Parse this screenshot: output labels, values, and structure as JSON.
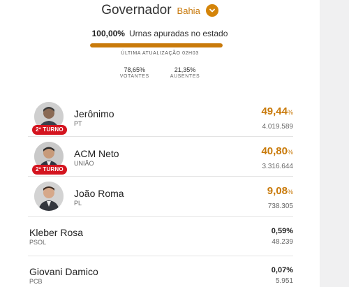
{
  "header": {
    "title": "Governador",
    "state": "Bahia",
    "icon": "chevron-down-icon"
  },
  "summary": {
    "apuradas_pct": "100,00%",
    "apuradas_label": "Urnas apuradas no estado",
    "progress": 1.0,
    "updated": "ÚLTIMA ATUALIZAÇÃO 02H03",
    "votantes_value": "78,65%",
    "votantes_label": "VOTANTES",
    "ausentes_value": "21,35%",
    "ausentes_label": "AUSENTES"
  },
  "candidates": [
    {
      "name": "Jerônimo",
      "party": "PT",
      "pct": "49,44",
      "pct_sign": "%",
      "votes": "4.019.589",
      "badge": "2º TURNO"
    },
    {
      "name": "ACM Neto",
      "party": "UNIÃO",
      "pct": "40,80",
      "pct_sign": "%",
      "votes": "3.316.644",
      "badge": "2º TURNO"
    },
    {
      "name": "João Roma",
      "party": "PL",
      "pct": "9,08",
      "pct_sign": "%",
      "votes": "738.305"
    },
    {
      "name": "Kleber Rosa",
      "party": "PSOL",
      "pct": "0,59",
      "pct_sign": "%",
      "votes": "48.239"
    },
    {
      "name": "Giovani Damico",
      "party": "PCB",
      "pct": "0,07",
      "pct_sign": "%",
      "votes": "5.951"
    }
  ],
  "colors": {
    "accent": "#c97a0a",
    "badge": "#d4141f"
  }
}
